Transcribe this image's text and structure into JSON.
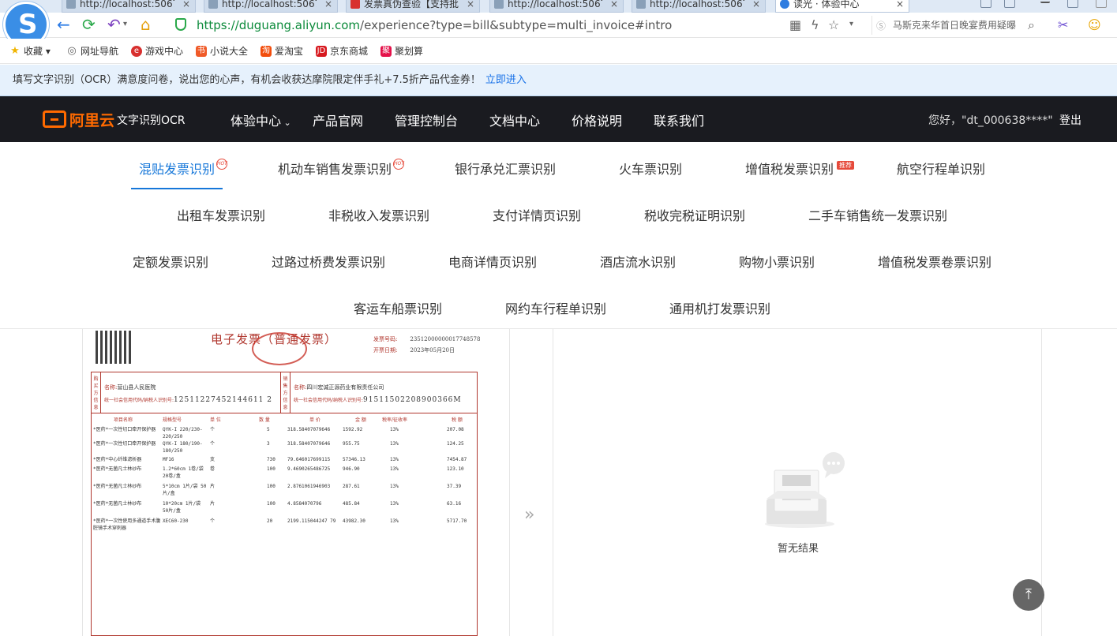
{
  "browser": {
    "tabs": [
      {
        "label": "http://localhost:5067/",
        "active": false
      },
      {
        "label": "http://localhost:5067/",
        "active": false
      },
      {
        "label": "发票真伪查验【支持批",
        "active": false
      },
      {
        "label": "http://localhost:5067/",
        "active": false
      },
      {
        "label": "http://localhost:5067/",
        "active": false
      },
      {
        "label": "读光 · 体验中心",
        "active": true
      }
    ],
    "url_host": "https://duguang.aliyun.com",
    "url_rest": "/experience?type=bill&subtype=multi_invoice#intro",
    "search_text": "马斯克来华首日晚宴费用疑曝"
  },
  "bookmarks": [
    {
      "label": "收藏",
      "icon": "star-icon"
    },
    {
      "label": "网址导航",
      "icon": "globe-icon"
    },
    {
      "label": "游戏中心",
      "icon": "game-icon"
    },
    {
      "label": "小说大全",
      "icon": "book-icon"
    },
    {
      "label": "爱淘宝",
      "icon": "taobao-icon"
    },
    {
      "label": "京东商城",
      "icon": "jd-icon"
    },
    {
      "label": "聚划算",
      "icon": "juhuasuan-icon"
    }
  ],
  "notice": {
    "text": "填写文字识别（OCR）满意度问卷，说出您的心声，有机会收获达摩院限定伴手礼+7.5折产品代金券！",
    "link": "立即进入"
  },
  "header": {
    "brand": "阿里云",
    "product": "文字识别OCR",
    "nav": [
      "体验中心",
      "产品官网",
      "管理控制台",
      "文档中心",
      "价格说明",
      "联系我们"
    ],
    "greeting": "您好，\"dt_000638****\"",
    "login": "登出"
  },
  "categories": {
    "row1": [
      "混贴发票识别",
      "机动车销售发票识别",
      "银行承兑汇票识别",
      "火车票识别",
      "增值税发票识别",
      "航空行程单识别"
    ],
    "row2": [
      "出租车发票识别",
      "非税收入发票识别",
      "支付详情页识别",
      "税收完税证明识别",
      "二手车销售统一发票识别"
    ],
    "row3": [
      "定额发票识别",
      "过路过桥费发票识别",
      "电商详情页识别",
      "酒店流水识别",
      "购物小票识别",
      "增值税发票卷票识别"
    ],
    "row4": [
      "客运车船票识别",
      "网约车行程单识别",
      "通用机打发票识别"
    ],
    "hot_badge": "HOT",
    "recommend_badge": "推荐",
    "active": "混贴发票识别"
  },
  "invoice": {
    "title": "电子发票（普通发票）",
    "code_label": "发票号码:",
    "code_value": "23512000000017748578",
    "date_label": "开票日期:",
    "date_value": "2023年05月20日",
    "buyer_name_label": "名称:",
    "buyer_name": "营山县人民医院",
    "buyer_tax_label": "统一社会信用代码/纳税人识别号:",
    "buyer_tax": "12511227452144611 2",
    "seller_name": "四川宏诚正源药业有限责任公司",
    "seller_tax": "91511502208900366M",
    "buyer_side": "购买方信息",
    "seller_side": "销售方信息",
    "headers": [
      "项目名称",
      "规格型号",
      "单 位",
      "数 量",
      "单 价",
      "金 额",
      "税率/征收率",
      "税 额"
    ],
    "rows": [
      [
        "*医药*一次性切口牵开保护器",
        "QYK-I 220/230-220/250",
        "个",
        "5",
        "318.58407079646",
        "1592.92",
        "13%",
        "207.08"
      ],
      [
        "*医药*一次性切口牵开保护器",
        "QYK-I 180/190-180/250",
        "个",
        "3",
        "318.58407079646",
        "955.75",
        "13%",
        "124.25"
      ],
      [
        "*医药*中心纤维滤析器",
        "MF16",
        "支",
        "730",
        "79.646017699115",
        "57346.13",
        "13%",
        "7454.87"
      ],
      [
        "*医药*无菌凡士林纱布",
        "1.2*60cm 1卷/袋 20卷/盒",
        "卷",
        "100",
        "9.4690265486725",
        "946.90",
        "13%",
        "123.10"
      ],
      [
        "*医药*无菌凡士林纱布",
        "5*10cm 1片/袋 50片/盒",
        "片",
        "100",
        "2.8761061946903",
        "287.61",
        "13%",
        "37.39"
      ],
      [
        "*医药*无菌凡士林纱布",
        "10*20cm 1片/袋 50片/盒",
        "片",
        "100",
        "4.8584070796",
        "485.84",
        "13%",
        "63.16"
      ],
      [
        "*医药*一次性使用多通道手术腹腔镜手术穿刺器",
        "XEC60-230",
        "个",
        "20",
        "2199.115044247 79",
        "43982.30",
        "13%",
        "5717.70"
      ]
    ]
  },
  "result": {
    "empty_text": "暂无结果"
  }
}
